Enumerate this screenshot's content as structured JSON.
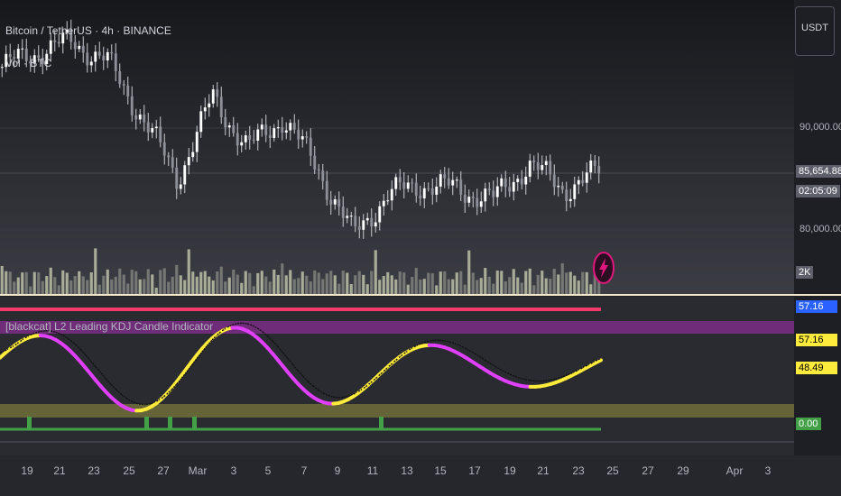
{
  "header": {
    "symbol_title": "Bitcoin / TetherUS · 4h · BINANCE",
    "volume_label": "Vol · BTC",
    "currency_button": "USDT"
  },
  "price_axis": {
    "labels": [
      "90,000.00",
      "80,000.00",
      "2K"
    ],
    "last_price": "85,654.88",
    "countdown": "02:05:09"
  },
  "indicator": {
    "title": "[blackcat] L2 Leading KDJ Candle Indicator",
    "values": [
      "57.16",
      "57.16",
      "48.49",
      "0.00"
    ]
  },
  "time_axis": {
    "labels": [
      "19",
      "21",
      "23",
      "25",
      "27",
      "Mar",
      "3",
      "5",
      "7",
      "9",
      "11",
      "13",
      "15",
      "17",
      "19",
      "21",
      "23",
      "25",
      "27",
      "29",
      "Apr",
      "3"
    ]
  },
  "colors": {
    "background": "#1e1f24",
    "candle": "#ffffff",
    "volume": "#d4d8b8",
    "k_line": "#e040fb",
    "d_line": "#ffeb3b",
    "signal_green": "#43a047",
    "top_band": "#f23b6b"
  },
  "chart_data": {
    "type": "line",
    "title": "Bitcoin / TetherUS · 4h · BINANCE",
    "x": [
      "19",
      "21",
      "23",
      "25",
      "27",
      "Mar",
      "3",
      "5",
      "7",
      "9",
      "11",
      "13",
      "15",
      "17",
      "19",
      "21",
      "23",
      "25"
    ],
    "series": [
      {
        "name": "Bitcoin / TetherUS",
        "values": [
          96000,
          97500,
          98500,
          96500,
          91000,
          85000,
          93000,
          88000,
          91000,
          86000,
          79500,
          83500,
          84500,
          84000,
          83000,
          86500,
          84000,
          85654.88
        ]
      }
    ],
    "ylim": [
      76000,
      100000
    ],
    "y_ticks": [
      80000,
      90000
    ],
    "legend": "none"
  }
}
